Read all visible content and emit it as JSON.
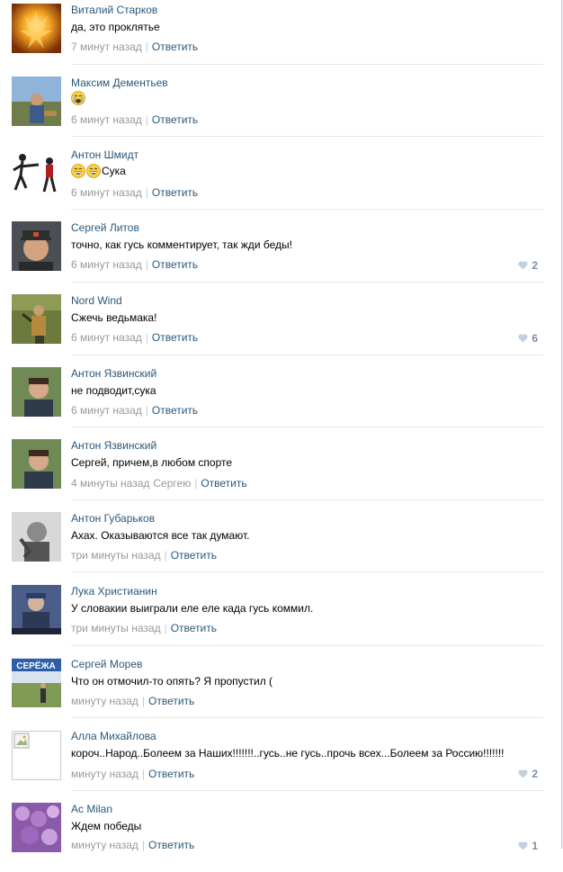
{
  "reply_label": "Ответить",
  "comments": [
    {
      "author": "Виталий Старков",
      "text": "да, это проклятье",
      "time": "7 минут назад",
      "likes": ""
    },
    {
      "author": "Максим Дементьев",
      "text": "",
      "time": "6 минут назад",
      "likes": ""
    },
    {
      "author": "Антон Шмидт",
      "text": "Сука",
      "time": "6 минут назад",
      "likes": ""
    },
    {
      "author": "Сергей Литов",
      "text": "точно, как гусь комментирует, так жди беды!",
      "time": "6 минут назад",
      "likes": "2"
    },
    {
      "author": "Nord Wind",
      "text": "Сжечь ведьмака!",
      "time": "6 минут назад",
      "likes": "6"
    },
    {
      "author": "Антон Язвинский",
      "text": "не подводит,сука",
      "time": "6 минут назад",
      "likes": ""
    },
    {
      "author": "Антон Язвинский",
      "text": "Сергей, причем,в любом спорте",
      "time": "4 минуты назад",
      "reply_to": "Сергею",
      "likes": ""
    },
    {
      "author": "Антон Губарьков",
      "text": "Ахах. Оказываются все так думают.",
      "time": "три минуты назад",
      "likes": ""
    },
    {
      "author": "Лука Христианин",
      "text": "У словакии выиграли еле еле када гусь коммил.",
      "time": "три минуты назад",
      "likes": ""
    },
    {
      "author": "Сергей Морев",
      "text": "Что он отмочил-то опять? Я пропустил (",
      "time": "минуту назад",
      "likes": ""
    },
    {
      "author": "Алла Михайлова",
      "text": "короч..Народ..Болеем за Наших!!!!!!!..гусь..не гусь..прочь всех...Болеем за Россию!!!!!!!",
      "time": "минуту назад",
      "likes": "2"
    },
    {
      "author": "Ac Milan",
      "text": "Ждем победы",
      "time": "минуту назад",
      "likes": "1"
    }
  ],
  "avatar_labels": {
    "seryozha_sign": "СЕРЁЖА"
  },
  "colors": {
    "link": "#2b587a",
    "meta": "#999999",
    "divider": "#e7e8ec",
    "like": "#7c8ea3"
  }
}
